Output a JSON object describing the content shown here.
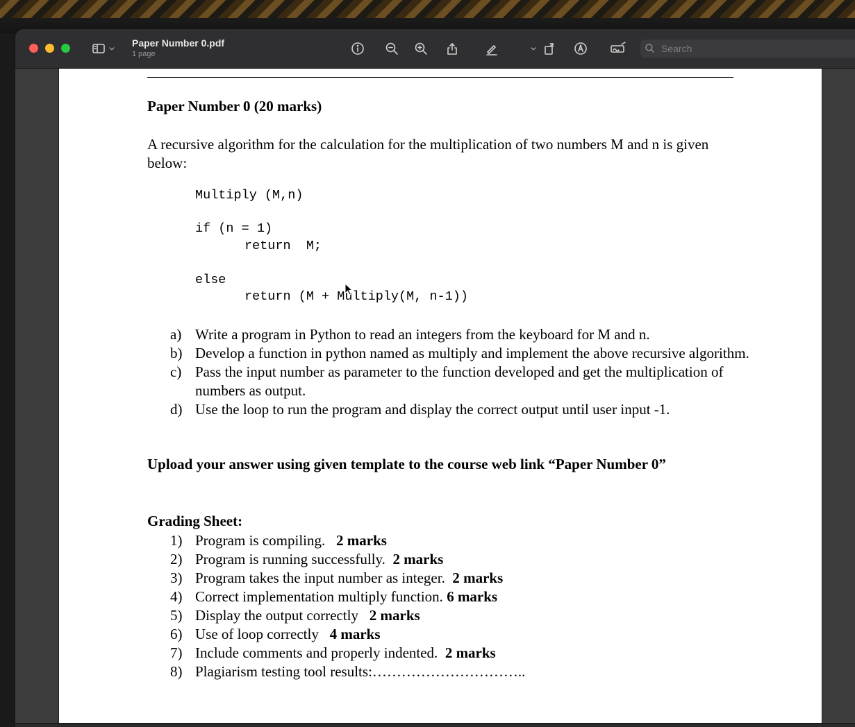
{
  "window": {
    "title": "Paper Number 0.pdf",
    "subtitle": "1 page",
    "search_placeholder": "Search"
  },
  "toolbar": {
    "icons": [
      "sidebar-icon",
      "chevron-down-icon",
      "info-icon",
      "zoom-out-icon",
      "zoom-in-icon",
      "share-icon",
      "highlight-pen-icon",
      "chevron-down-icon",
      "rotate-icon",
      "markup-icon",
      "sign-icon",
      "search-icon"
    ]
  },
  "document": {
    "heading": "Paper Number 0 (20 marks)",
    "intro": "A recursive algorithm for the calculation for the multiplication of two numbers M and n is given below:",
    "code": {
      "line1": "Multiply (M,n)",
      "line2": "if (n = 1)",
      "line3": "return  M;",
      "line4": "else",
      "line5": "return (M + Multiply(M, n-1))"
    },
    "questions": [
      {
        "label": "a)",
        "text": "Write a program in Python to read an integers from the keyboard for M and n."
      },
      {
        "label": "b)",
        "text": "Develop a function in python named as multiply and implement the above recursive algorithm."
      },
      {
        "label": "c)",
        "text": "Pass the input number as parameter to the function developed and get the multiplication of numbers as output."
      },
      {
        "label": "d)",
        "text": "Use the loop to run the program and display the correct output until user input -1."
      }
    ],
    "upload_note": "Upload your answer using given template to the course web link “Paper Number 0”",
    "grading_title": "Grading Sheet:",
    "grading": [
      {
        "label": "1)",
        "text": "Program is compiling.",
        "marks": "2 marks"
      },
      {
        "label": "2)",
        "text": "Program is running successfully.",
        "marks": "2 marks"
      },
      {
        "label": "3)",
        "text": "Program takes the input number as integer.",
        "marks": "2 marks"
      },
      {
        "label": "4)",
        "text": "Correct implementation multiply function.",
        "marks": "6 marks"
      },
      {
        "label": "5)",
        "text": "Display the output correctly",
        "marks": "2 marks"
      },
      {
        "label": "6)",
        "text": "Use of loop correctly",
        "marks": "4 marks"
      },
      {
        "label": "7)",
        "text": "Include comments and properly indented.",
        "marks": "2 marks"
      },
      {
        "label": "8)",
        "text": "Plagiarism testing tool results:…………………………..",
        "marks": ""
      }
    ]
  }
}
